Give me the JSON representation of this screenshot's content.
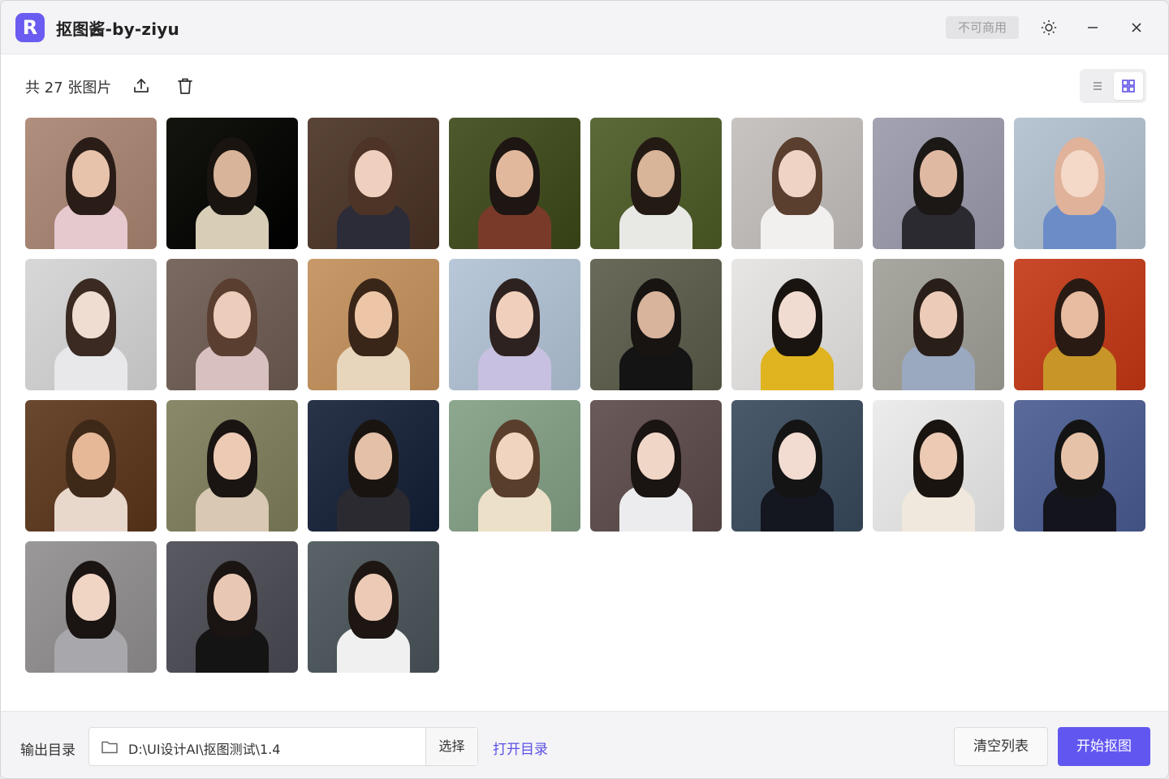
{
  "app": {
    "logo_letter": "R",
    "title": "抠图酱-by-ziyu",
    "badge": "不可商用"
  },
  "toolbar": {
    "count_text": "共 27 张图片",
    "view_mode": "grid"
  },
  "images": [
    {
      "bg": "#b08f7e",
      "skin": "#e8c3ac",
      "hair": "#2a1d18",
      "cloth": "#e6c8cf"
    },
    {
      "bg": "#14140f",
      "skin": "#d8b49a",
      "hair": "#1a1410",
      "cloth": "#d8cdb7"
    },
    {
      "bg": "#5a4538",
      "skin": "#efcfbd",
      "hair": "#4d3426",
      "cloth": "#2c2c38"
    },
    {
      "bg": "#4e5a2e",
      "skin": "#e2b89c",
      "hair": "#1e1612",
      "cloth": "#7a3a2a"
    },
    {
      "bg": "#5c6a3a",
      "skin": "#d8b498",
      "hair": "#241a14",
      "cloth": "#e8e8e4"
    },
    {
      "bg": "#c8c4c2",
      "skin": "#efd3c4",
      "hair": "#5a3e2e",
      "cloth": "#f2f0ee"
    },
    {
      "bg": "#a3a3b3",
      "skin": "#e0b9a2",
      "hair": "#1c1816",
      "cloth": "#2a2a30"
    },
    {
      "bg": "#b8c6d4",
      "skin": "#f4d8c8",
      "hair": "#e0b29a",
      "cloth": "#6c8cc8"
    },
    {
      "bg": "#d8d8d8",
      "skin": "#f0ddd2",
      "hair": "#3a2a22",
      "cloth": "#e8e8ea"
    },
    {
      "bg": "#7a6a62",
      "skin": "#ecccba",
      "hair": "#5a3e30",
      "cloth": "#d8c0c0"
    },
    {
      "bg": "#c89a6a",
      "skin": "#edc6a8",
      "hair": "#3a2618",
      "cloth": "#e8d6bc"
    },
    {
      "bg": "#b8c8d8",
      "skin": "#f0d0bc",
      "hair": "#2e2220",
      "cloth": "#c8c0e0"
    },
    {
      "bg": "#6a6a5a",
      "skin": "#d8b49c",
      "hair": "#181412",
      "cloth": "#141414"
    },
    {
      "bg": "#e8e6e4",
      "skin": "#f0dcd0",
      "hair": "#1a1410",
      "cloth": "#e0b420"
    },
    {
      "bg": "#a8a8a0",
      "skin": "#ecccb8",
      "hair": "#2a1e18",
      "cloth": "#9aa8c0"
    },
    {
      "bg": "#c84a2a",
      "skin": "#e8bca0",
      "hair": "#2a1a14",
      "cloth": "#c89628"
    },
    {
      "bg": "#6a4830",
      "skin": "#e6b898",
      "hair": "#3e2818",
      "cloth": "#e8d8cc"
    },
    {
      "bg": "#8a8a6a",
      "skin": "#eccab4",
      "hair": "#1a1412",
      "cloth": "#d8c8b4"
    },
    {
      "bg": "#2a3448",
      "skin": "#e4c0a8",
      "hair": "#1a1410",
      "cloth": "#2a2a30"
    },
    {
      "bg": "#8ea890",
      "skin": "#f0d4c0",
      "hair": "#5a3e2c",
      "cloth": "#ece0c8"
    },
    {
      "bg": "#6a5a5a",
      "skin": "#f0d6c6",
      "hair": "#1a1412",
      "cloth": "#ececee"
    },
    {
      "bg": "#4a5a6a",
      "skin": "#f2dcd2",
      "hair": "#141414",
      "cloth": "#141620"
    },
    {
      "bg": "#ececec",
      "skin": "#eccab4",
      "hair": "#1a1410",
      "cloth": "#f0e8dc"
    },
    {
      "bg": "#5a6a9a",
      "skin": "#e6c2a8",
      "hair": "#141414",
      "cloth": "#14141c"
    },
    {
      "bg": "#9a9898",
      "skin": "#f0d4c4",
      "hair": "#1a1412",
      "cloth": "#a8a8ac"
    },
    {
      "bg": "#5a5a62",
      "skin": "#e8c8b4",
      "hair": "#1a1412",
      "cloth": "#141414"
    },
    {
      "bg": "#5a6468",
      "skin": "#eccab6",
      "hair": "#1e1612",
      "cloth": "#f0f0f0"
    }
  ],
  "footer": {
    "output_label": "输出目录",
    "path": "D:\\UI设计AI\\抠图测试\\1.4",
    "choose_label": "选择",
    "open_dir_label": "打开目录",
    "clear_label": "清空列表",
    "start_label": "开始抠图"
  }
}
